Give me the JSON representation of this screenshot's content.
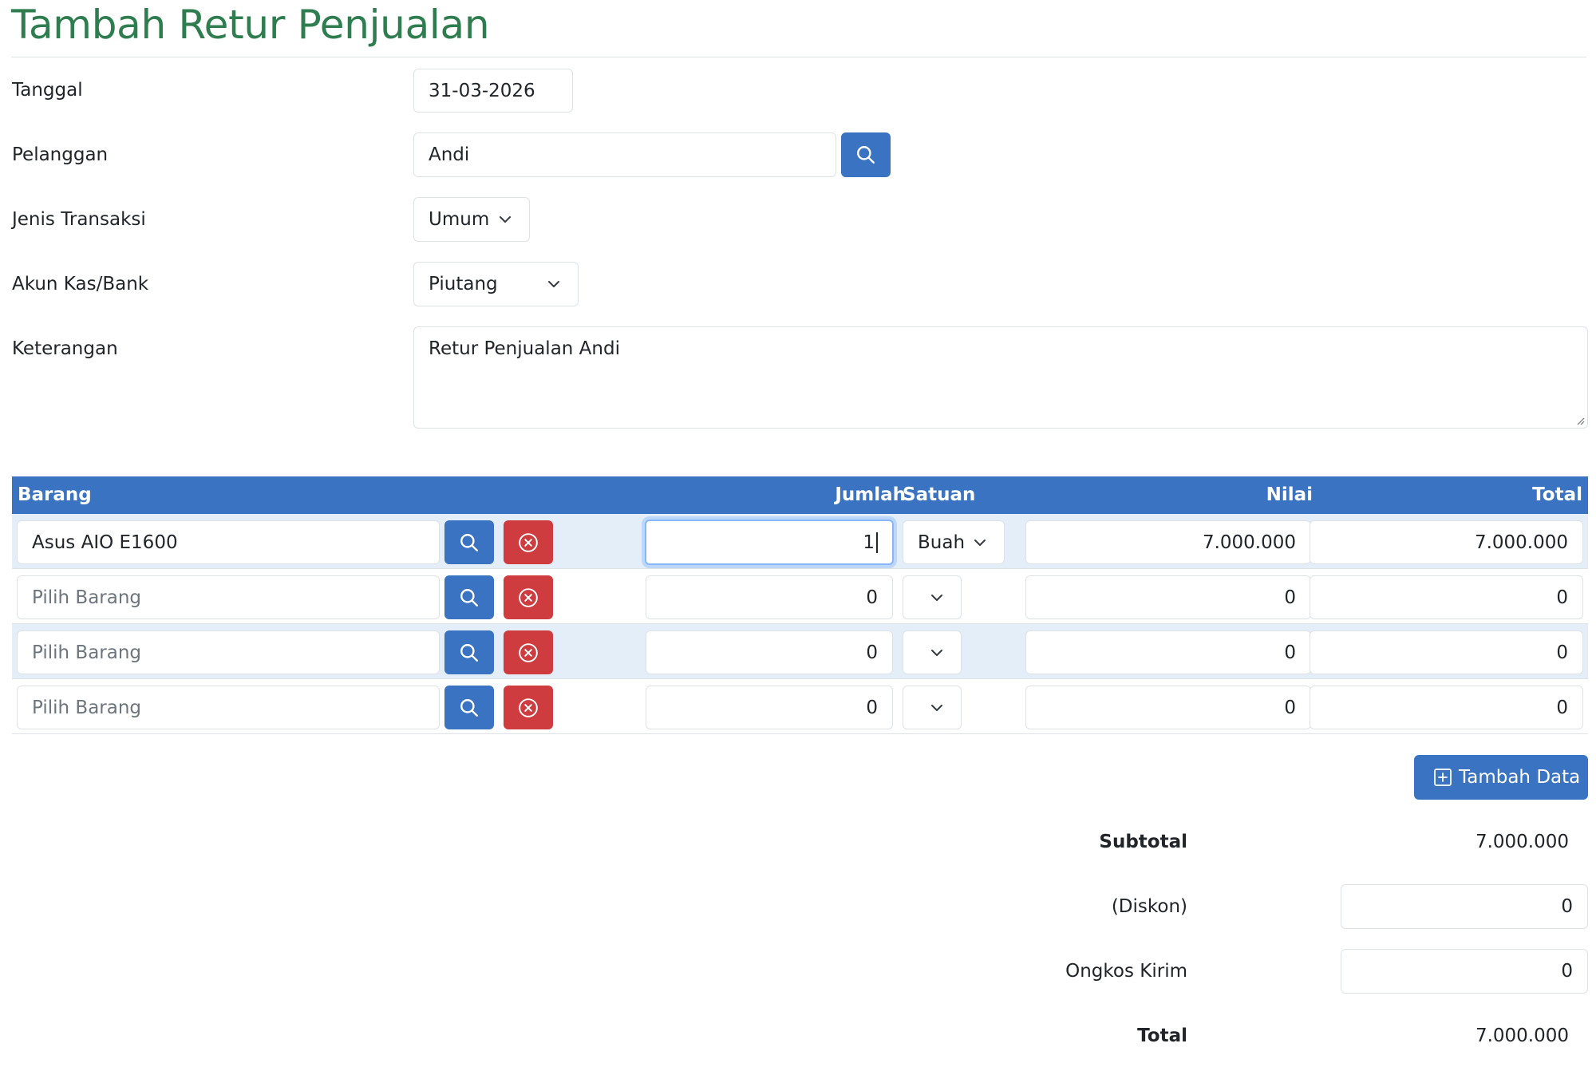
{
  "page": {
    "title": "Tambah Retur Penjualan"
  },
  "form": {
    "tanggal": {
      "label": "Tanggal",
      "value": "31-03-2026"
    },
    "pelanggan": {
      "label": "Pelanggan",
      "value": "Andi"
    },
    "jenis_transaksi": {
      "label": "Jenis Transaksi",
      "value": "Umum"
    },
    "akun": {
      "label": "Akun Kas/Bank",
      "value": "Piutang"
    },
    "keterangan": {
      "label": "Keterangan",
      "value": "Retur Penjualan Andi"
    }
  },
  "table": {
    "headers": {
      "barang": "Barang",
      "jumlah": "Jumlah",
      "satuan": "Satuan",
      "nilai": "Nilai",
      "total": "Total"
    },
    "rows": [
      {
        "barang": "Asus AIO E1600",
        "barang_placeholder": "Pilih Barang",
        "jumlah": "1",
        "satuan": "Buah",
        "nilai": "7.000.000",
        "total": "7.000.000"
      },
      {
        "barang": "",
        "barang_placeholder": "Pilih Barang",
        "jumlah": "0",
        "satuan": "",
        "nilai": "0",
        "total": "0"
      },
      {
        "barang": "",
        "barang_placeholder": "Pilih Barang",
        "jumlah": "0",
        "satuan": "",
        "nilai": "0",
        "total": "0"
      },
      {
        "barang": "",
        "barang_placeholder": "Pilih Barang",
        "jumlah": "0",
        "satuan": "",
        "nilai": "0",
        "total": "0"
      }
    ],
    "add_button": "Tambah Data"
  },
  "summary": {
    "subtotal": {
      "label": "Subtotal",
      "value": "7.000.000"
    },
    "diskon": {
      "label": "(Diskon)",
      "value": "0"
    },
    "ongkos_kirim": {
      "label": "Ongkos Kirim",
      "value": "0"
    },
    "total": {
      "label": "Total",
      "value": "7.000.000"
    }
  },
  "icons": {
    "search": "search-icon",
    "remove": "x-circle-icon",
    "dropdown": "chevron-down-icon",
    "add": "plus-square-icon"
  },
  "colors": {
    "title": "#2e7d4f",
    "primary": "#3a73c1",
    "danger": "#cf3c3f",
    "stripe": "#e3eef9"
  }
}
